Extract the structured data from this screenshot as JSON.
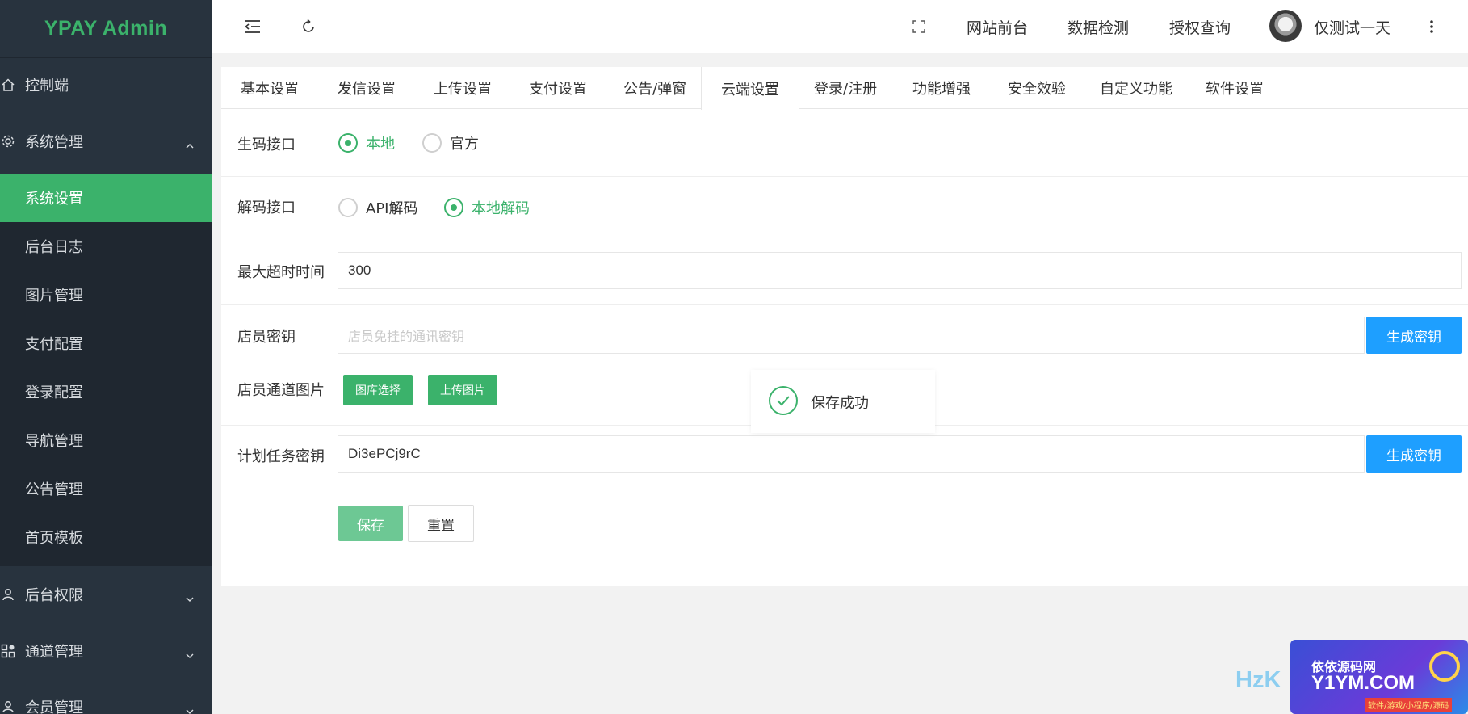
{
  "app": {
    "title": "YPAY Admin"
  },
  "sidebar": {
    "items": [
      {
        "label": "控制端",
        "icon": "home-icon"
      },
      {
        "label": "系统管理",
        "icon": "gear-icon",
        "expanded": true,
        "children": [
          "系统设置",
          "后台日志",
          "图片管理",
          "支付配置",
          "登录配置",
          "导航管理",
          "公告管理",
          "首页模板"
        ],
        "active_child": "系统设置"
      },
      {
        "label": "后台权限",
        "icon": "user-icon"
      },
      {
        "label": "通道管理",
        "icon": "apps-icon"
      },
      {
        "label": "会员管理",
        "icon": "member-icon"
      }
    ]
  },
  "header": {
    "links": [
      "网站前台",
      "数据检测",
      "授权查询"
    ],
    "user_name": "仅测试一天"
  },
  "tabs": [
    "基本设置",
    "发信设置",
    "上传设置",
    "支付设置",
    "公告/弹窗",
    "云端设置",
    "登录/注册",
    "功能增强",
    "安全效验",
    "自定义功能",
    "软件设置"
  ],
  "active_tab": "云端设置",
  "form": {
    "gen_code": {
      "label": "生码接口",
      "options": [
        "本地",
        "官方"
      ],
      "selected": "本地"
    },
    "decode": {
      "label": "解码接口",
      "options": [
        "API解码",
        "本地解码"
      ],
      "selected": "本地解码"
    },
    "timeout": {
      "label": "最大超时时间",
      "value": "300"
    },
    "clerk_key": {
      "label": "店员密钥",
      "value": "",
      "placeholder": "店员免挂的通讯密钥",
      "button": "生成密钥"
    },
    "clerk_image": {
      "label": "店员通道图片",
      "buttons": [
        "图库选择",
        "上传图片"
      ]
    },
    "cron_key": {
      "label": "计划任务密钥",
      "value": "Di3ePCj9rC",
      "button": "生成密钥"
    },
    "save": "保存",
    "reset": "重置"
  },
  "toast": {
    "text": "保存成功"
  },
  "watermark": {
    "text": "HzK",
    "logo_title": "依依源码网",
    "logo_domain": "Y1YM.COM",
    "logo_tagline": "软件/游戏/小程序/源码"
  },
  "colors": {
    "sidebar_bg": "#28333e",
    "submenu_bg": "#1f2730",
    "accent_green": "#3bb26b",
    "accent_blue": "#1e9fff"
  }
}
